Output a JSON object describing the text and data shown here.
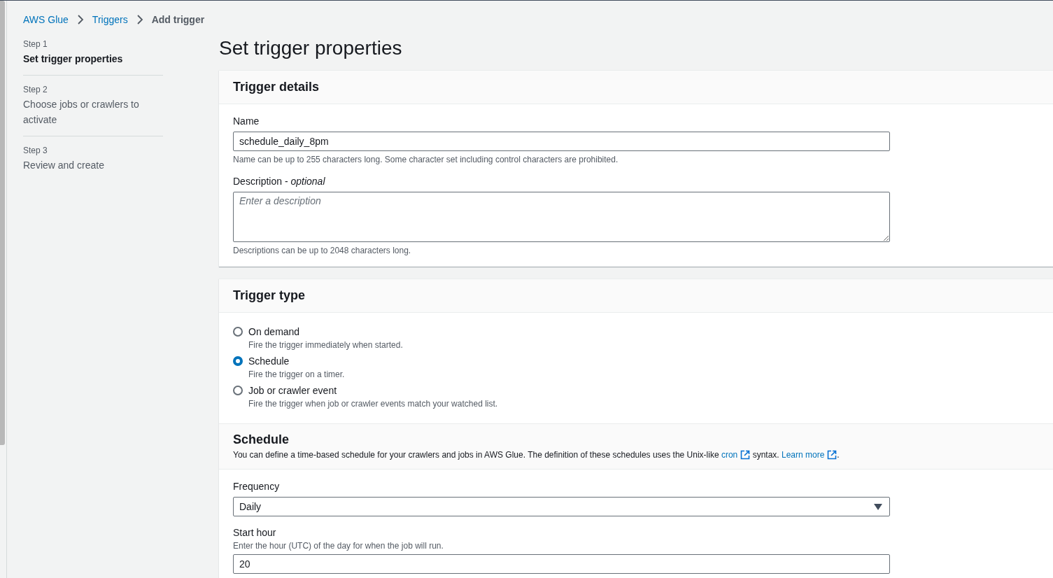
{
  "breadcrumb": [
    {
      "label": "AWS Glue",
      "kind": "link"
    },
    {
      "label": "Triggers",
      "kind": "link"
    },
    {
      "label": "Add trigger",
      "kind": "current"
    }
  ],
  "steps": [
    {
      "step": "Step 1",
      "label": "Set trigger properties",
      "selected": true
    },
    {
      "step": "Step 2",
      "label": "Choose jobs or crawlers to activate",
      "selected": false
    },
    {
      "step": "Step 3",
      "label": "Review and create",
      "selected": false
    }
  ],
  "page_title": "Set trigger properties",
  "trigger_details": {
    "title": "Trigger details",
    "name": {
      "label": "Name",
      "value": "schedule_daily_8pm",
      "hint": "Name can be up to 255 characters long. Some character set including control characters are prohibited."
    },
    "description": {
      "label": "Description - *optional*",
      "placeholder": "Enter a description",
      "hint": "Descriptions can be up to 2048 characters long."
    }
  },
  "trigger_type": {
    "title": "Trigger type",
    "options": [
      {
        "label": "On demand",
        "description": "Fire the trigger immediately when started.",
        "selected": false
      },
      {
        "label": "Schedule",
        "description": "Fire the trigger on a timer.",
        "selected": true
      },
      {
        "label": "Job or crawler event",
        "description": "Fire the trigger when job or crawler events match your watched list.",
        "selected": false
      }
    ]
  },
  "schedule": {
    "title": "Schedule",
    "description": [
      {
        "kind": "text",
        "text": "You can define a time-based schedule for your crawlers and jobs in AWS Glue. The definition of these schedules uses the Unix-like "
      },
      {
        "kind": "link",
        "text": "cron"
      },
      {
        "kind": "text",
        "text": " syntax. "
      },
      {
        "kind": "link",
        "text": "Learn more"
      },
      {
        "kind": "text",
        "text": "."
      }
    ],
    "frequency": {
      "label": "Frequency",
      "value": "Daily"
    },
    "start_hour": {
      "label": "Start hour",
      "hint": "Enter the hour (UTC) of the day for when the job will run.",
      "value": "20"
    }
  }
}
